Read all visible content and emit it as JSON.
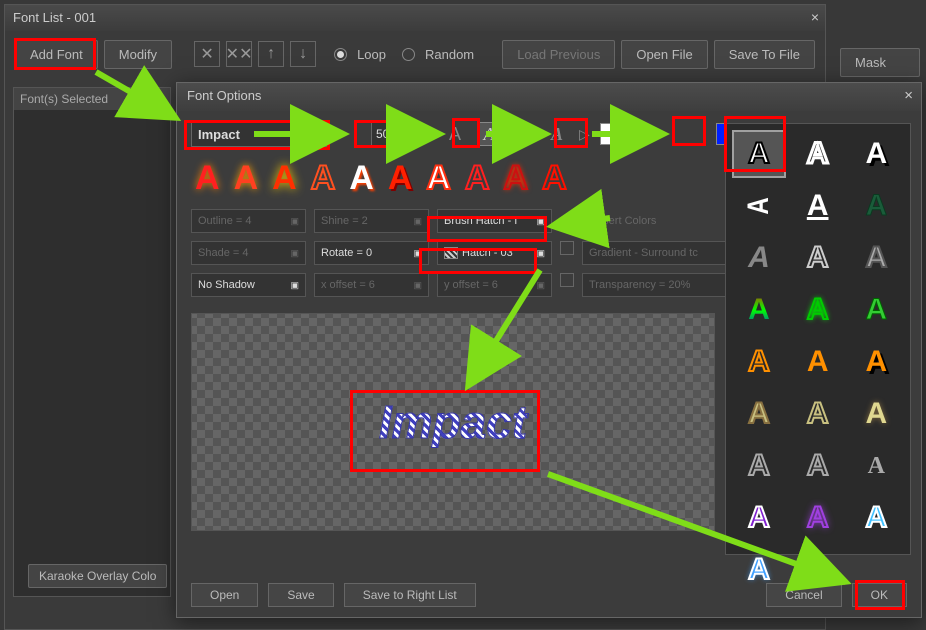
{
  "main": {
    "title": "Font List - 001",
    "add_font": "Add Font",
    "modify": "Modify",
    "loop": "Loop",
    "random": "Random",
    "load_prev": "Load Previous",
    "open_file": "Open File",
    "save_file": "Save To File",
    "side_head": "Font(s) Selected",
    "karaoke": "Karaoke Overlay Colo"
  },
  "edge": {
    "mask": "Mask"
  },
  "modal": {
    "title": "Font Options",
    "font_name": "Impact",
    "font_size": "50",
    "outline": "Outline = 4",
    "shine": "Shine = 2",
    "brush": "Brush Hatch - I",
    "insert": "Insert Colors",
    "shade": "Shade = 4",
    "rotate": "Rotate = 0",
    "hatch": "Hatch - 03",
    "gradient": "Gradient - Surround tc",
    "no_shadow": "No Shadow",
    "xoff": "x offset = 6",
    "yoff": "y offset = 6",
    "transp": "Transparency = 20%",
    "preview_text": "Impact",
    "open": "Open",
    "save": "Save",
    "save_right": "Save to Right List",
    "cancel": "Cancel",
    "ok": "OK",
    "colors": {
      "fill": "#ffffff",
      "outline": "#0020ff"
    }
  }
}
